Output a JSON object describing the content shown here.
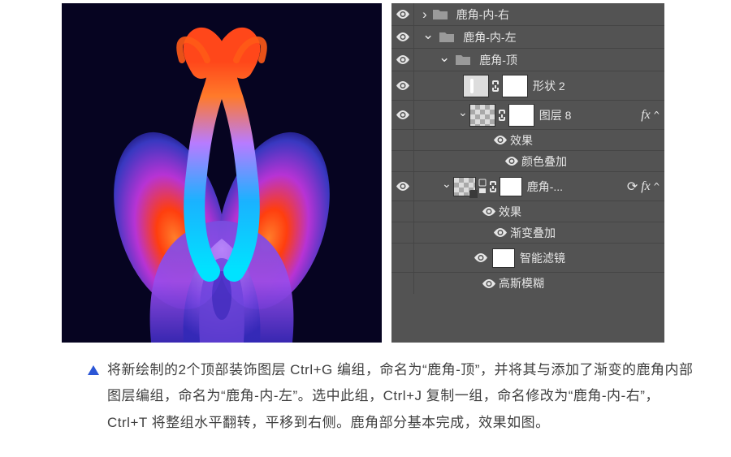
{
  "layers": {
    "row1": "鹿角-内-右",
    "row2": "鹿角-内-左",
    "row3": "鹿角-顶",
    "row4": "形状 2",
    "row5": "图层 8",
    "row5_fx": "fx",
    "row6": "效果",
    "row7": "颜色叠加",
    "row8": "鹿角-...",
    "row8_so_icon": "⟳",
    "row8_fx": "fx",
    "row9": "效果",
    "row10": "渐变叠加",
    "row11": "智能滤镜",
    "row12": "高斯模糊"
  },
  "caption": "将新绘制的2个顶部装饰图层 Ctrl+G 编组，命名为“鹿角-顶”，并将其与添加了渐变的鹿角内部图层编组，命名为“鹿角-内-左”。选中此组，Ctrl+J 复制一组，命名修改为“鹿角-内-右”，Ctrl+T 将整组水平翻转，平移到右侧。鹿角部分基本完成，效果如图。"
}
